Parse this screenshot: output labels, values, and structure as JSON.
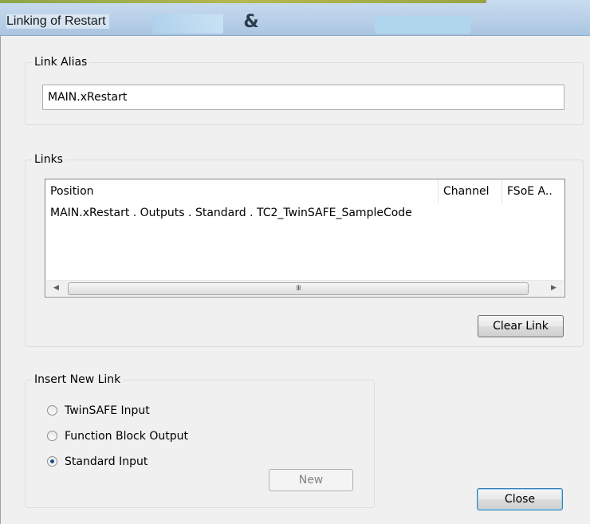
{
  "window": {
    "title": "Linking of Restart"
  },
  "link_alias": {
    "legend": "Link Alias",
    "value": "MAIN.xRestart"
  },
  "links": {
    "legend": "Links",
    "columns": [
      "Position",
      "Channel",
      "FSoE A.."
    ],
    "rows": [
      {
        "position": "MAIN.xRestart . Outputs . Standard . TC2_TwinSAFE_SampleCode",
        "channel": "",
        "fsoe": ""
      }
    ],
    "scroll_left_icon": "scroll-left-arrow",
    "scroll_right_icon": "scroll-right-arrow",
    "scroll_thumb_grip": "III",
    "clear_link_label": "Clear Link"
  },
  "insert_new_link": {
    "legend": "Insert New Link",
    "options": [
      {
        "label": "TwinSAFE Input",
        "selected": false
      },
      {
        "label": "Function Block Output",
        "selected": false
      },
      {
        "label": "Standard Input",
        "selected": true
      }
    ],
    "new_label": "New"
  },
  "footer": {
    "close_label": "Close"
  }
}
